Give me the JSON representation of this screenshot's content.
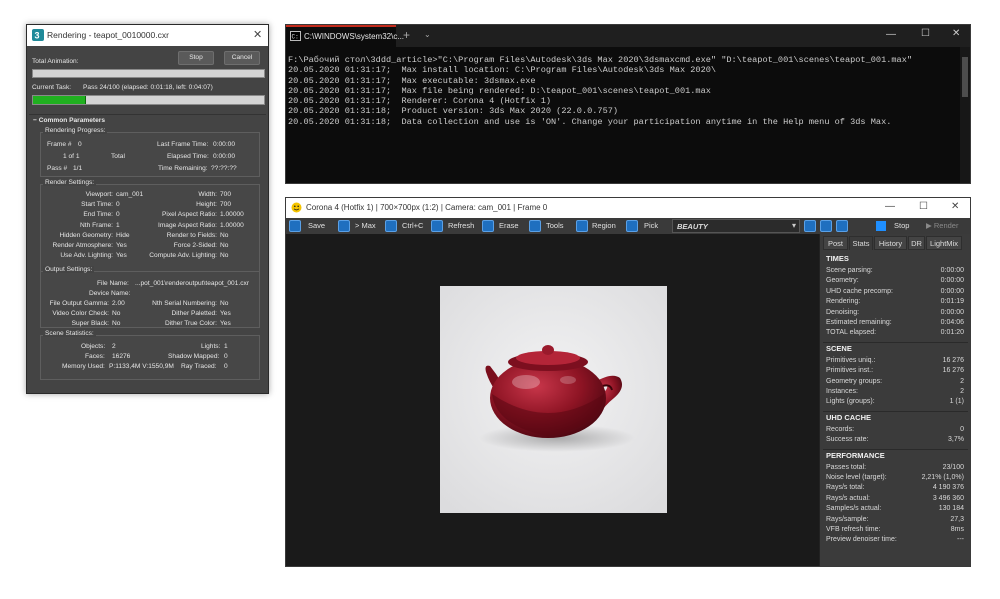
{
  "rendering": {
    "title": "Rendering - teapot_0010000.cxr",
    "total_animation": "Total Animation:",
    "stop": "Stop",
    "cancel": "Cancel",
    "current_task": "Current Task:",
    "task_text": "Pass 24/100 (elapsed: 0:01:18, left: 0:04:07)",
    "progress_fraction": 0.23,
    "common": "Common Parameters",
    "progress_head": "Rendering Progress:",
    "frame": "Frame #",
    "frame_v": "0",
    "of": "1 of 1",
    "total": "Total",
    "pass": "Pass #",
    "pass_v": "1/1",
    "last_frame": "Last Frame Time:",
    "last_frame_v": "0:00:00",
    "elapsed": "Elapsed Time:",
    "elapsed_v": "0:00:00",
    "remaining": "Time Remaining:",
    "remaining_v": "??:??:??",
    "render_settings": "Render Settings:",
    "settings": [
      [
        "Viewport:",
        "cam_001",
        "Width:",
        "700"
      ],
      [
        "Start Time:",
        "0",
        "Height:",
        "700"
      ],
      [
        "End Time:",
        "0",
        "Pixel Aspect Ratio:",
        "1.00000"
      ],
      [
        "Nth Frame:",
        "1",
        "Image Aspect Ratio:",
        "1.00000"
      ],
      [
        "Hidden Geometry:",
        "Hide",
        "Render to Fields:",
        "No"
      ],
      [
        "Render Atmosphere:",
        "Yes",
        "Force 2-Sided:",
        "No"
      ],
      [
        "Use Adv. Lighting:",
        "Yes",
        "Compute Adv. Lighting:",
        "No"
      ]
    ],
    "output_head": "Output Settings:",
    "file_name": "File Name:",
    "file_name_v": "...pot_001\\renderoutput\\teapot_001.cxr",
    "device_name": "Device Name:",
    "output_rows": [
      [
        "File Output Gamma:",
        "2.00",
        "Nth Serial Numbering:",
        "No"
      ],
      [
        "Video Color Check:",
        "No",
        "Dither Paletted:",
        "Yes"
      ],
      [
        "Super Black:",
        "No",
        "Dither True Color:",
        "Yes"
      ]
    ],
    "scene_head": "Scene Statistics:",
    "objects": "Objects:",
    "objects_v": "2",
    "lights": "Lights:",
    "lights_v": "1",
    "faces": "Faces:",
    "faces_v": "16276",
    "shadow": "Shadow Mapped:",
    "shadow_v": "0",
    "memory": "Memory Used:",
    "memory_v": "P:1133,4M V:1550,9M",
    "raytraced": "Ray Traced:",
    "raytraced_v": "0"
  },
  "cmd": {
    "tab_title": "C:\\WINDOWS\\system32\\c...",
    "plus": "+",
    "lines": [
      "F:\\Рабочий стол\\3ddd_article>\"C:\\Program Files\\Autodesk\\3ds Max 2020\\3dsmaxcmd.exe\" \"D:\\teapot_001\\scenes\\teapot_001.max\"",
      "20.05.2020 01:31:17;  Max install location: C:\\Program Files\\Autodesk\\3ds Max 2020\\",
      "20.05.2020 01:31:17;  Max executable: 3dsmax.exe",
      "20.05.2020 01:31:17;  Max file being rendered: D:\\teapot_001\\scenes\\teapot_001.max",
      "20.05.2020 01:31:17;  Renderer: Corona 4 (Hotfix 1)",
      "20.05.2020 01:31:18;  Product version: 3ds Max 2020 (22.0.0.757)",
      "20.05.2020 01:31:18;  Data collection and use is 'ON'. Change your participation anytime in the Help menu of 3ds Max."
    ]
  },
  "vfb": {
    "title": "Corona 4 (Hotfix 1) | 700×700px (1:2) | Camera: cam_001 | Frame 0",
    "toolbar": {
      "save": "Save",
      "max": "> Max",
      "ctrlc": "Ctrl+C",
      "refresh": "Refresh",
      "erase": "Erase",
      "tools": "Tools",
      "region": "Region",
      "pick": "Pick",
      "pass": "BEAUTY",
      "stop": "Stop",
      "render": "Render"
    },
    "tabs": [
      "Post",
      "Stats",
      "History",
      "DR",
      "LightMix"
    ],
    "sections": [
      {
        "title": "TIMES",
        "rows": [
          [
            "Scene parsing:",
            "0:00:00"
          ],
          [
            "Geometry:",
            "0:00:00"
          ],
          [
            "UHD cache precomp:",
            "0:00:00"
          ],
          [
            "Rendering:",
            "0:01:19"
          ],
          [
            "Denoising:",
            "0:00:00"
          ],
          [
            "Estimated remaining:",
            "0:04:06"
          ],
          [
            "TOTAL elapsed:",
            "0:01:20"
          ]
        ]
      },
      {
        "title": "SCENE",
        "rows": [
          [
            "Primitives uniq.:",
            "16 276"
          ],
          [
            "Primitives inst.:",
            "16 276"
          ],
          [
            "Geometry groups:",
            "2"
          ],
          [
            "Instances:",
            "2"
          ],
          [
            "Lights (groups):",
            "1 (1)"
          ]
        ]
      },
      {
        "title": "UHD CACHE",
        "rows": [
          [
            "Records:",
            "0"
          ],
          [
            "Success rate:",
            "3,7%"
          ]
        ]
      },
      {
        "title": "PERFORMANCE",
        "rows": [
          [
            "Passes total:",
            "23/100"
          ],
          [
            "Noise level (target):",
            "2,21% (1,0%)"
          ],
          [
            "Rays/s total:",
            "4 190 376"
          ],
          [
            "Rays/s actual:",
            "3 496 360"
          ],
          [
            "Samples/s actual:",
            "130 184"
          ],
          [
            "Rays/sample:",
            "27,3"
          ],
          [
            "VFB refresh time:",
            "8ms"
          ],
          [
            "Preview denoiser time:",
            "---"
          ]
        ]
      }
    ],
    "colors": {
      "teapot": "#8e1424",
      "accent": "#1f6fbf"
    }
  }
}
